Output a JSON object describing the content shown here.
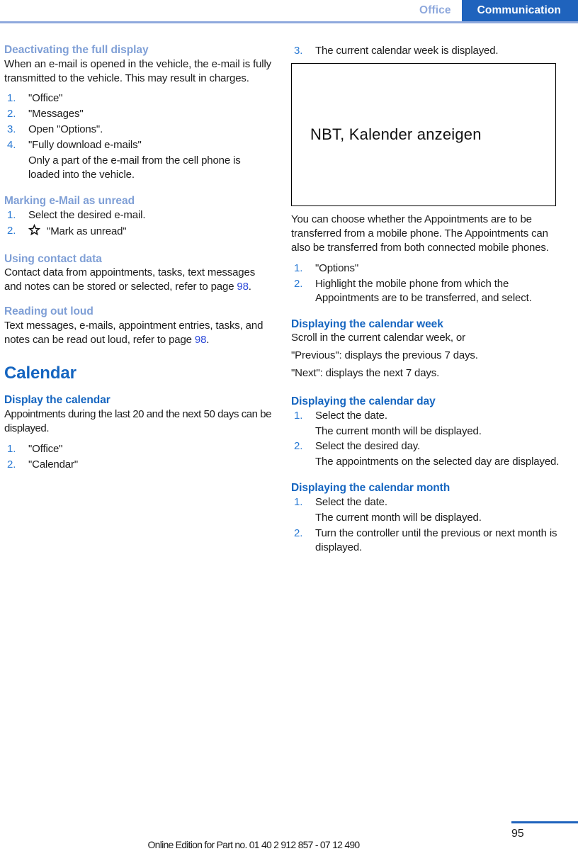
{
  "header": {
    "tab_inactive": "Office",
    "tab_active": "Communication",
    "accent_active_bg": "#1f63bd",
    "accent_inactive_text": "#8fa9dd",
    "rule_color": "#8fa9dd"
  },
  "colors": {
    "heading_muted": "#7f9fd6",
    "heading_strong": "#1565c0",
    "list_number": "#2a7ad4",
    "page_link": "#2a47d8",
    "body_text": "#1c1c1c"
  },
  "left_column": {
    "section_1": {
      "heading": "Deactivating the full display",
      "intro": "When an e-mail is opened in the vehicle, the e-mail is fully transmitted to the vehicle. This may result in charges.",
      "steps": [
        {
          "num": "1.",
          "text": "\"Office\""
        },
        {
          "num": "2.",
          "text": "\"Messages\""
        },
        {
          "num": "3.",
          "text": "Open \"Options\"."
        },
        {
          "num": "4.",
          "text": "\"Fully download e-mails\""
        }
      ],
      "step_note": "Only a part of the e-mail from the cell phone is loaded into the vehicle."
    },
    "section_2": {
      "heading": "Marking e-Mail as unread",
      "steps": [
        {
          "num": "1.",
          "text": "Select the desired e-mail."
        }
      ],
      "step2_num": "2.",
      "step2_icon": "star-outline-icon",
      "step2_text": "\"Mark as unread\""
    },
    "section_3": {
      "heading": "Using contact data",
      "body_before": "Contact data from appointments, tasks, text messages and notes can be stored or selected, refer to page ",
      "page_ref": "98",
      "body_after": "."
    },
    "section_4": {
      "heading": "Reading out loud",
      "body_before": "Text messages, e-mails, appointment entries, tasks, and notes can be read out loud, refer to page ",
      "page_ref": "98",
      "body_after": "."
    },
    "chapter": {
      "title": "Calendar",
      "section_1": {
        "heading": "Display the calendar",
        "body": "Appointments during the last 20 and the next 50 days can be displayed.",
        "steps": [
          {
            "num": "1.",
            "text": "\"Office\""
          },
          {
            "num": "2.",
            "text": "\"Calendar\""
          }
        ]
      }
    }
  },
  "right_column": {
    "continued_step": {
      "num": "3.",
      "text": "The current calendar week is displayed."
    },
    "figure": {
      "caption": "NBT, Kalender anzeigen"
    },
    "figure_body": "You can choose whether the Appointments are to be transferred from a mobile phone. The Appointments can also be transferred from both connected mobile phones.",
    "transfer_steps": [
      {
        "num": "1.",
        "text": "\"Options\""
      },
      {
        "num": "2.",
        "text": "Highlight the mobile phone from which the Appointments are to be transferred, and select."
      }
    ],
    "section_week": {
      "heading": "Displaying the calendar week",
      "lines": [
        "Scroll in the current calendar week, or",
        "\"Previous\": displays the previous 7 days.",
        "\"Next\": displays the next 7 days."
      ]
    },
    "section_day": {
      "heading": "Displaying the calendar day",
      "step1": {
        "num": "1.",
        "text": "Select the date."
      },
      "note1": "The current month will be displayed.",
      "step2": {
        "num": "2.",
        "text": "Select the desired day."
      },
      "note2": "The appointments on the selected day are displayed."
    },
    "section_month": {
      "heading": "Displaying the calendar month",
      "step1": {
        "num": "1.",
        "text": "Select the date."
      },
      "note1": "The current month will be displayed.",
      "step2": {
        "num": "2.",
        "text": "Turn the controller until the previous or next month is displayed."
      }
    }
  },
  "footer": {
    "note": "Online Edition for Part no. 01 40 2 912 857 - 07 12 490",
    "page_number": "95"
  }
}
